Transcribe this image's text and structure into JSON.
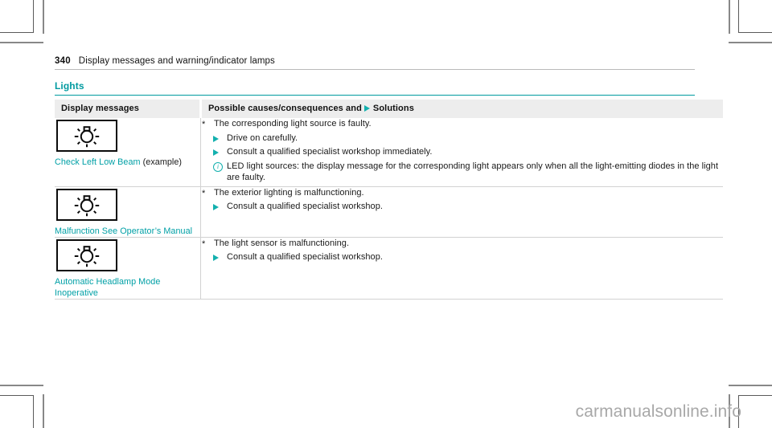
{
  "page": {
    "number": "340",
    "running_title": "Display messages and warning/indicator lamps",
    "section_heading": "Lights",
    "watermark": "carmanualsonline.info"
  },
  "table": {
    "headers": {
      "display_messages": "Display messages",
      "possible_causes_prefix": "Possible causes/consequences and",
      "solutions_suffix": "Solutions",
      "solution_marker_icon": "triangle-right-icon"
    },
    "rows": [
      {
        "symbol_icon": "bulb-failure-lamp-icon",
        "message_text": "Check Left Low Beam",
        "message_suffix": " (example)",
        "items": [
          {
            "kind": "cause",
            "marker": "asterisk",
            "text": "The corresponding light source is faulty."
          },
          {
            "kind": "solution",
            "marker": "triangle-right-icon",
            "text": "Drive on carefully."
          },
          {
            "kind": "solution",
            "marker": "triangle-right-icon",
            "text": "Consult a qualified specialist workshop immediately."
          },
          {
            "kind": "note",
            "marker": "info-circle-icon",
            "text": "LED light sources: the display message for the corresponding light appears only when all the light-emitting diodes in the light are faulty."
          }
        ]
      },
      {
        "symbol_icon": "bulb-failure-lamp-icon",
        "message_text": "Malfunction See Opera­tor’s Manual",
        "message_suffix": "",
        "items": [
          {
            "kind": "cause",
            "marker": "asterisk",
            "text": "The exterior lighting is malfunctioning."
          },
          {
            "kind": "solution",
            "marker": "triangle-right-icon",
            "text": "Consult a qualified specialist workshop."
          }
        ]
      },
      {
        "symbol_icon": "bulb-failure-lamp-icon",
        "message_text": "Automatic Headlamp Mode Inoperative",
        "message_suffix": "",
        "items": [
          {
            "kind": "cause",
            "marker": "asterisk",
            "text": "The light sensor is malfunctioning."
          },
          {
            "kind": "solution",
            "marker": "triangle-right-icon",
            "text": "Consult a qualified specialist workshop."
          }
        ]
      }
    ]
  },
  "colors": {
    "accent_teal": "#009aa0",
    "marker_teal": "#13b0ae",
    "header_band": "#ededed",
    "rule": "#d2d2d2"
  }
}
